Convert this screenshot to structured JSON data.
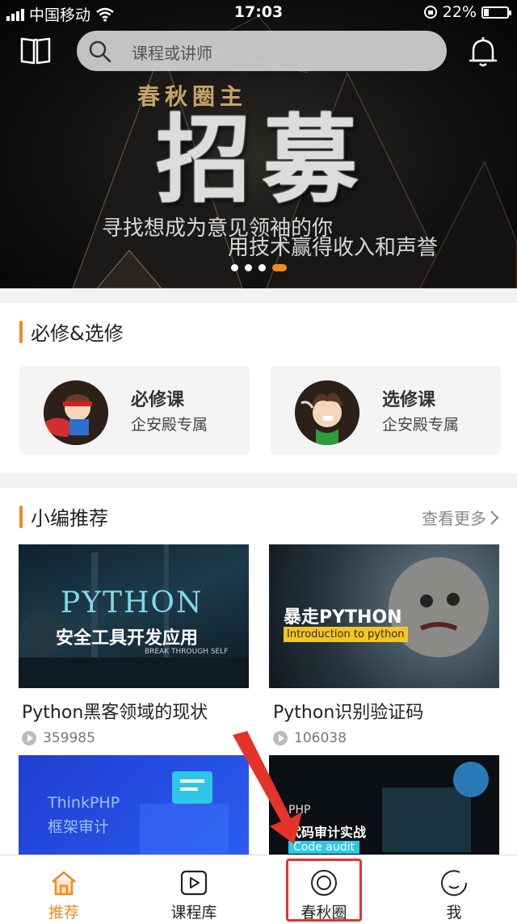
{
  "status_bar": {
    "carrier": "中国移动",
    "time": "17:03",
    "battery_percent": "22%",
    "battery_level": 0.22
  },
  "header": {
    "search_placeholder": "课程或讲师"
  },
  "banner": {
    "subtitle": "春秋圈主",
    "headline": "招募",
    "line1": "寻找想成为意见领袖的你",
    "line2": "用技术赢得收入和声誉",
    "slide_count": 4,
    "active_slide": 4
  },
  "required_section": {
    "title": "必修&选修",
    "cards": [
      {
        "title": "必修课",
        "subtitle": "企安殿专属"
      },
      {
        "title": "选修课",
        "subtitle": "企安殿专属"
      }
    ]
  },
  "recommend_section": {
    "title": "小编推荐",
    "more": "查看更多",
    "videos": [
      {
        "title": "Python黑客领域的现状",
        "plays": "359985",
        "thumb_text": "PYTHON",
        "thumb_sub": "安全工具开发应用",
        "thumb_tag": "BREAK THROUGH SELF"
      },
      {
        "title": "Python识别验证码",
        "plays": "106038",
        "thumb_text": "暴走PYTHON",
        "thumb_sub": "Introduction to python"
      },
      {
        "title": "",
        "plays": "",
        "thumb_text": "ThinkPHP",
        "thumb_sub": "框架审计"
      },
      {
        "title": "",
        "plays": "",
        "thumb_text": "PHP",
        "thumb_sub": "代码审计实战",
        "thumb_tag": "Code audit"
      }
    ]
  },
  "tabs": [
    {
      "label": "推荐",
      "icon": "home-icon",
      "active": true
    },
    {
      "label": "课程库",
      "icon": "play-icon",
      "active": false
    },
    {
      "label": "春秋圈",
      "icon": "circle-icon",
      "active": false
    },
    {
      "label": "我",
      "icon": "smile-icon",
      "active": false
    }
  ],
  "colors": {
    "accent": "#f28a1e",
    "annotation_red": "#e5332a"
  }
}
